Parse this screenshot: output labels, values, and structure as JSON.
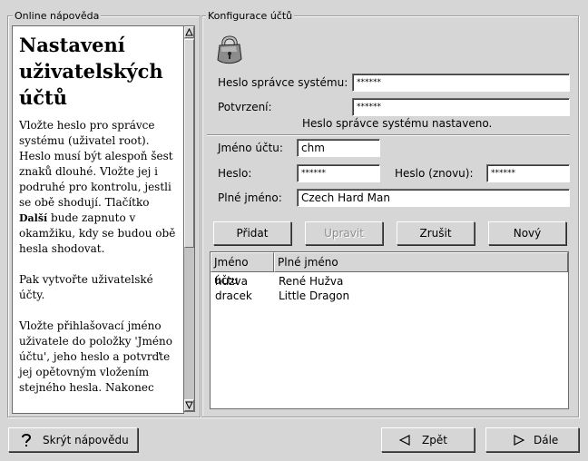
{
  "help_panel": {
    "title": "Online nápověda",
    "heading": "Nastavení uživatelských účtů",
    "p1_a": "Vložte heslo pro správce systému (uživatel root). Heslo musí být alespoň šest znaků dlouhé. Vložte jej i podruhé pro kontrolu, jestli se obě shodují. Tlačítko ",
    "p1_bold": "Další",
    "p1_b": " bude zapnuto v okamžiku, kdy se budou obě hesla shodovat.",
    "p2": "Pak vytvořte uživatelské účty.",
    "p3": "Vložte přihlašovací jméno uživatele do položky 'Jméno účtu', jeho heslo a potvrďte jej opětovným vložením stejného hesla. Nakonec"
  },
  "config": {
    "title": "Konfigurace účtů",
    "lock_icon": "padlock-icon",
    "root_password_label": "Heslo správce systému:",
    "root_password_value": "******",
    "confirm_label": "Potvrzení:",
    "confirm_value": "******",
    "status": "Heslo správce systému nastaveno.",
    "account_name_label": "Jméno účtu:",
    "account_name_value": "chm",
    "password_label": "Heslo:",
    "password_value": "******",
    "password_again_label": "Heslo (znovu):",
    "password_again_value": "******",
    "full_name_label": "Plné jméno:",
    "full_name_value": "Czech Hard Man",
    "buttons": {
      "add": "Přidat",
      "edit": "Upravit",
      "delete": "Zrušit",
      "new": "Nový"
    },
    "table": {
      "columns": [
        "Jméno účtu",
        "Plné jméno"
      ],
      "rows": [
        [
          "huzva",
          "René Hužva"
        ],
        [
          "dracek",
          "Little Dragon"
        ]
      ]
    }
  },
  "bottom": {
    "hide_help": "Skrýt nápovědu",
    "back": "Zpět",
    "next": "Dále"
  },
  "colors": {
    "background": "#d6d6d6",
    "disabled_text": "#8e8e8e"
  }
}
